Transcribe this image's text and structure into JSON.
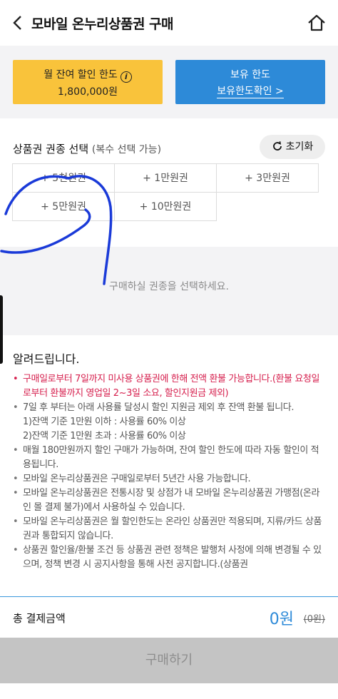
{
  "header": {
    "title": "모바일 온누리상품권 구매",
    "back_icon": "chevron-left-icon",
    "home_icon": "home-icon"
  },
  "limits": {
    "monthly_label": "월 잔여 할인 한도",
    "monthly_value": "1,800,000원",
    "holding_label": "보유 한도",
    "holding_link": "보유한도확인 >"
  },
  "selection": {
    "title": "상품권 권종 선택",
    "subtitle": "(복수 선택 가능)",
    "reset_label": "초기화",
    "options": [
      "+ 5천원권",
      "+ 1만원권",
      "+ 3만원권",
      "+ 5만원권",
      "+ 10만원권"
    ],
    "empty_message": "구매하실 권종을 선택하세요."
  },
  "notice": {
    "title": "알려드립니다.",
    "items": [
      "구매일로부터 7일까지 미사용 상품권에 한해 전액 환불 가능합니다.(환불 요청일로부터 환불까지 영업일 2~3일 소요, 할인지원금 제외)",
      "7일 후 부터는 아래 사용률 달성시 할인 지원금 제외 후 잔액 환불 됩니다.",
      "1)잔액 기준 1만원 이하 : 사용률 60% 이상",
      "2)잔액 기준 1만원 초과 : 사용률 60% 이상",
      "매월 180만원까지 할인 구매가 가능하며, 잔여 할인 한도에 따라 자동 할인이 적용됩니다.",
      "모바일 온누리상품권은 구매일로부터 5년간 사용 가능합니다.",
      "모바일 온누리상품권은 전통시장 및 상점가 내 모바일 온누리상품권 가맹점(온라인 몰 결제 불가)에서 사용하실 수 있습니다.",
      "모바일 온누리상품권은 월 할인한도는 온라인 상품권만 적용되며, 지류/카드 상품권과 통합되지 않습니다.",
      "상품권 할인율/환불 조건 등 상품권 관련 정책은 발행처 사정에 의해 변경될 수 있으며, 정책 변경 시 공지사항을 통해 사전 공지합니다.(상품권"
    ]
  },
  "total": {
    "label": "총 결제금액",
    "amount": "0원",
    "original": "(0원)"
  },
  "buy_label": "구매하기",
  "colors": {
    "yellow": "#f9c33b",
    "blue": "#2d8ad8",
    "red": "#d6204e",
    "scribble": "#1a3ad8"
  }
}
